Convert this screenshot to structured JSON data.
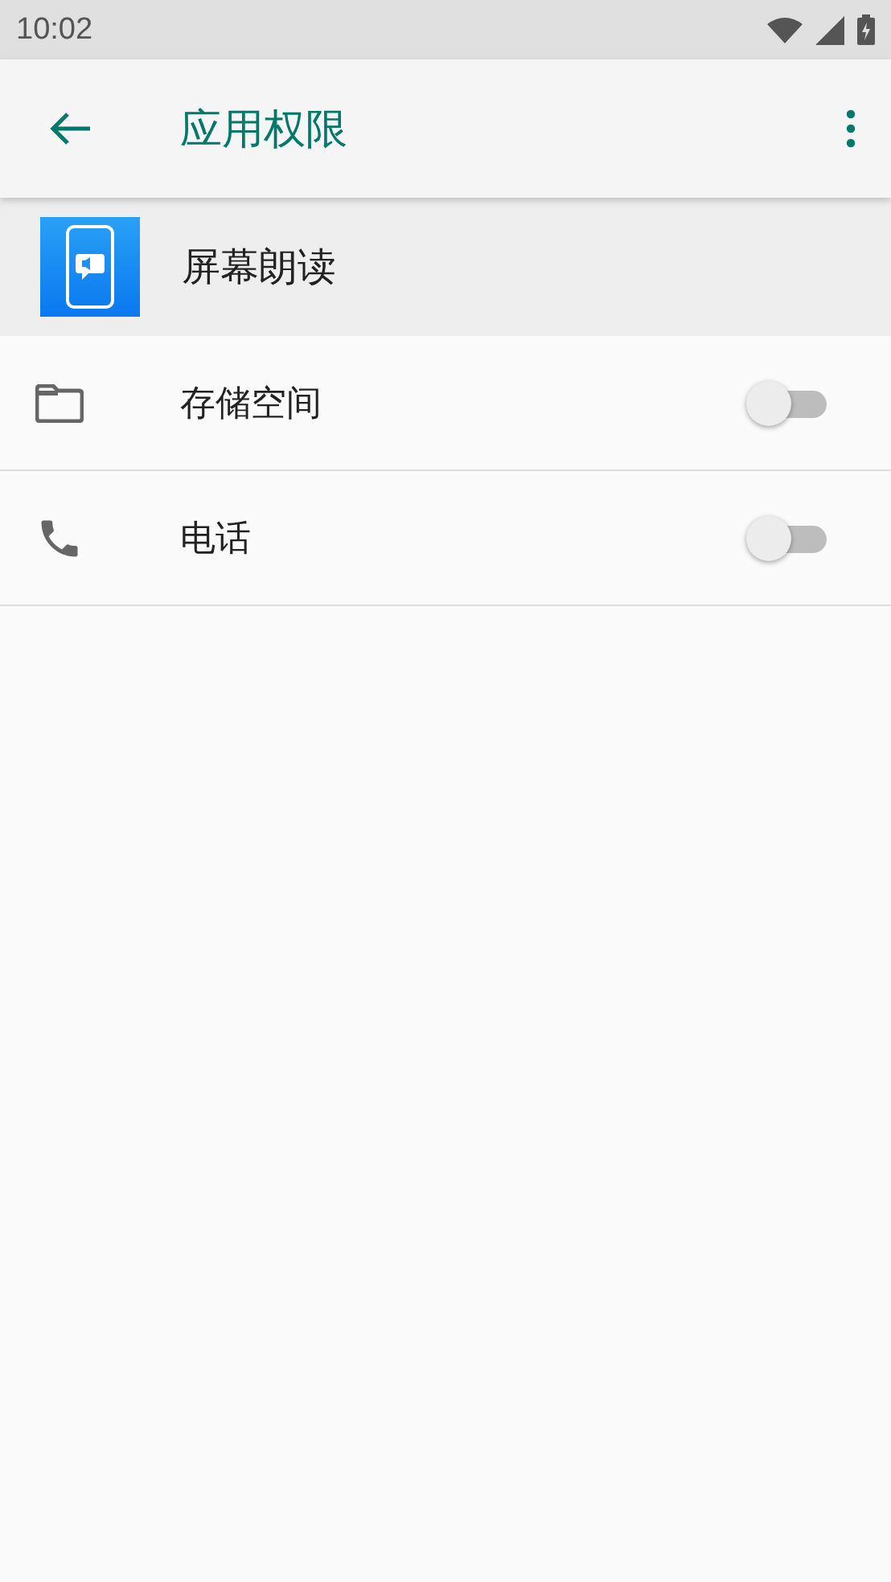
{
  "status_bar": {
    "time": "10:02"
  },
  "app_bar": {
    "title": "应用权限"
  },
  "app": {
    "name": "屏幕朗读"
  },
  "permissions": [
    {
      "kind": "folder",
      "label": "存储空间",
      "on": false
    },
    {
      "kind": "phone",
      "label": "电话",
      "on": false
    }
  ]
}
